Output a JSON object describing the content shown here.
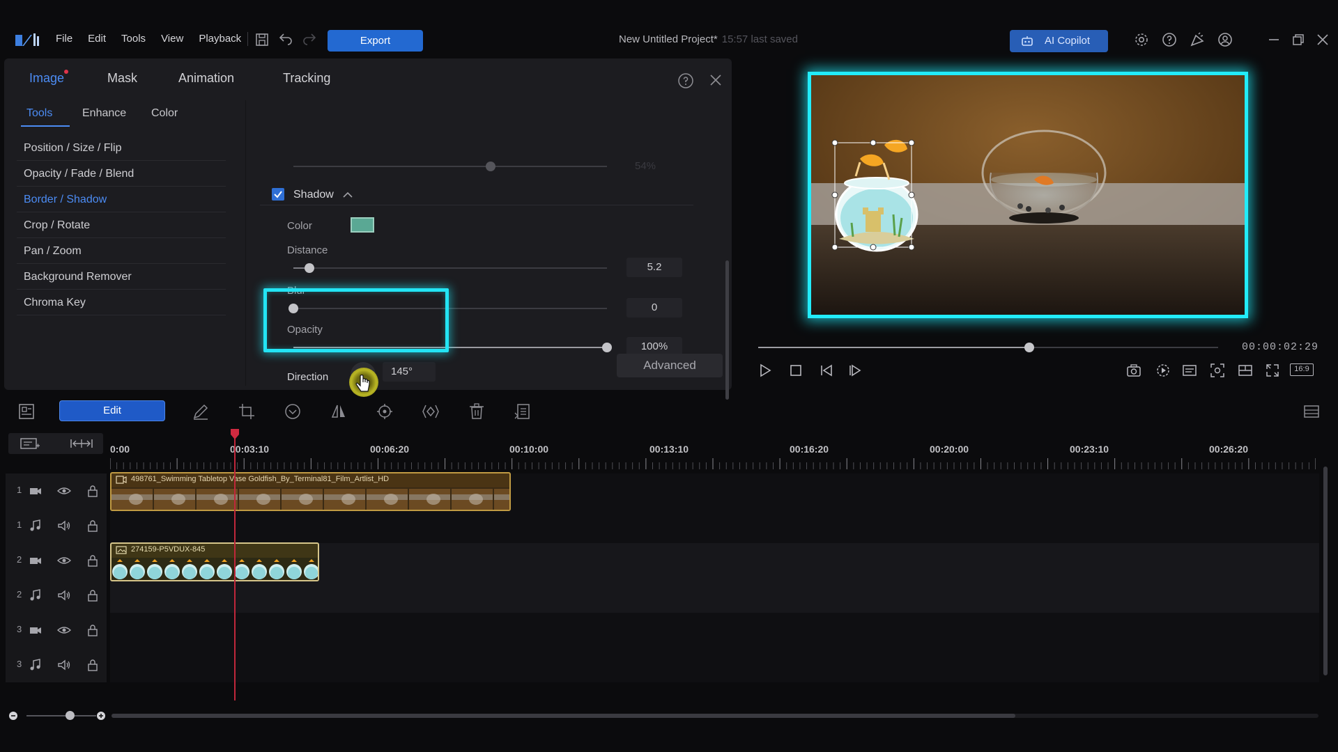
{
  "menu": [
    "File",
    "Edit",
    "Tools",
    "View",
    "Playback"
  ],
  "export_label": "Export",
  "project": {
    "title": "New Untitled Project*",
    "saved": "15:57 last saved"
  },
  "ai_copilot_label": "AI Copilot",
  "panel": {
    "tabs": [
      "Image",
      "Mask",
      "Animation",
      "Tracking"
    ],
    "active_tab": "Image",
    "subtabs": [
      "Tools",
      "Enhance",
      "Color"
    ],
    "active_subtab": "Tools",
    "tools": [
      "Position / Size / Flip",
      "Opacity / Fade / Blend",
      "Border / Shadow",
      "Crop / Rotate",
      "Pan / Zoom",
      "Background Remover",
      "Chroma Key"
    ],
    "active_tool": "Border / Shadow",
    "top_value": "54%",
    "shadow": {
      "title": "Shadow",
      "enabled": true,
      "color_label": "Color",
      "color": "#5aa894",
      "distance_label": "Distance",
      "distance_value": "5.2",
      "distance_level": 0.05,
      "blur_label": "Blur",
      "blur_value": "0",
      "blur_level": 0.0,
      "opacity_label": "Opacity",
      "opacity_value": "100%",
      "opacity_level": 1.0,
      "direction_label": "Direction",
      "direction_value": "145°"
    },
    "advanced_label": "Advanced"
  },
  "preview": {
    "timecode": "00:00:02:29",
    "progress": 0.59,
    "aspect_label": "16:9"
  },
  "toolbar": {
    "edit_label": "Edit"
  },
  "timeline": {
    "ruler_labels": [
      "0:00",
      "00:03:10",
      "00:06:20",
      "00:10:00",
      "00:13:10",
      "00:16:20",
      "00:20:00",
      "00:23:10",
      "00:26:20"
    ],
    "tracks": [
      {
        "num": "1",
        "type": "video"
      },
      {
        "num": "1",
        "type": "audio"
      },
      {
        "num": "2",
        "type": "video"
      },
      {
        "num": "2",
        "type": "audio"
      },
      {
        "num": "3",
        "type": "video"
      },
      {
        "num": "3",
        "type": "audio"
      }
    ],
    "clip1_title": "498761_Swimming Tabletop Vase Goldfish_By_Terminal81_Film_Artlist_HD",
    "clip2_title": "274159-P5VDUX-845"
  },
  "colors": {
    "accent": "#4c8cf4",
    "highlight": "#23e4f4",
    "playhead": "#c0273b"
  }
}
